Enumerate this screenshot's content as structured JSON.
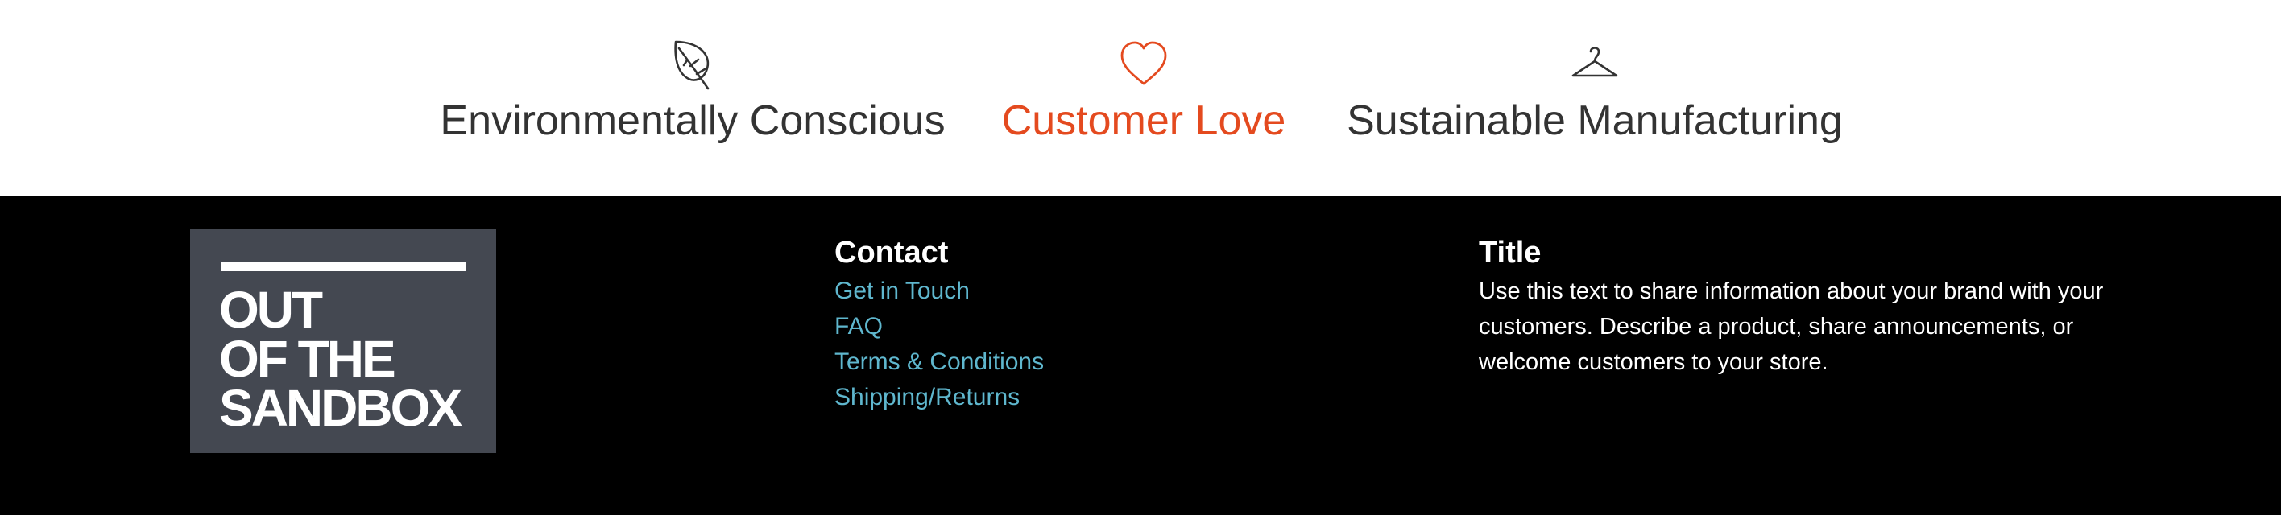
{
  "features": [
    {
      "icon": "leaf-icon",
      "label": "Environmentally Conscious",
      "highlighted": false
    },
    {
      "icon": "heart-icon",
      "label": "Customer Love",
      "highlighted": true
    },
    {
      "icon": "hanger-icon",
      "label": "Sustainable Manufacturing",
      "highlighted": false
    }
  ],
  "colors": {
    "text": "#333333",
    "accent": "#e44a1f",
    "footer_bg": "#000000",
    "logo_bg": "#444851",
    "link": "#5fb7ce"
  },
  "footer": {
    "logo": {
      "lines": [
        "OUT",
        "OF THE",
        "SANDBOX"
      ]
    },
    "contact": {
      "heading": "Contact",
      "links": [
        "Get in Touch",
        "FAQ",
        "Terms & Conditions",
        "Shipping/Returns"
      ]
    },
    "info": {
      "heading": "Title",
      "text": "Use this text to share information about your brand with your customers. Describe a product, share announcements, or welcome customers to your store."
    }
  }
}
